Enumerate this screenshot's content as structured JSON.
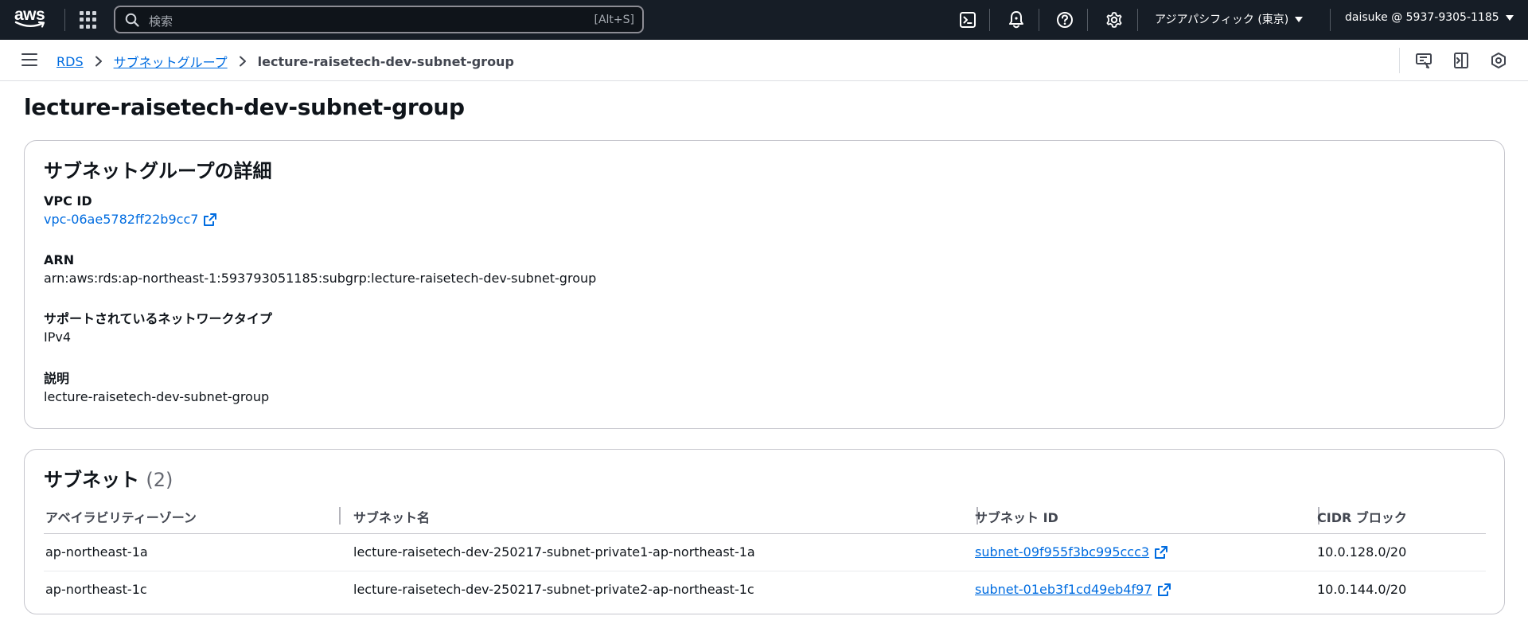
{
  "topnav": {
    "logo_text": "aws",
    "search_placeholder": "検索",
    "search_shortcut": "[Alt+S]",
    "region": "アジアパシフィック (東京)",
    "account": "daisuke @ 5937-9305-1185",
    "icons": [
      "cloudshell-icon",
      "notifications-icon",
      "help-icon",
      "settings-icon"
    ]
  },
  "breadcrumb": {
    "items": [
      "RDS",
      "サブネットグループ",
      "lecture-raisetech-dev-subnet-group"
    ]
  },
  "page": {
    "title": "lecture-raisetech-dev-subnet-group"
  },
  "details": {
    "title": "サブネットグループの詳細",
    "vpc_label": "VPC ID",
    "vpc_value": "vpc-06ae5782ff22b9cc7",
    "arn_label": "ARN",
    "arn_value": "arn:aws:rds:ap-northeast-1:593793051185:subgrp:lecture-raisetech-dev-subnet-group",
    "network_label": "サポートされているネットワークタイプ",
    "network_value": "IPv4",
    "desc_label": "説明",
    "desc_value": "lecture-raisetech-dev-subnet-group"
  },
  "subnets": {
    "title": "サブネット",
    "count": "(2)",
    "columns": [
      "アベイラビリティーゾーン",
      "サブネット名",
      "サブネット ID",
      "CIDR ブロック"
    ],
    "rows": [
      {
        "az": "ap-northeast-1a",
        "name": "lecture-raisetech-dev-250217-subnet-private1-ap-northeast-1a",
        "id": "subnet-09f955f3bc995ccc3",
        "cidr": "10.0.128.0/20"
      },
      {
        "az": "ap-northeast-1c",
        "name": "lecture-raisetech-dev-250217-subnet-private2-ap-northeast-1c",
        "id": "subnet-01eb3f1cd49eb4f97",
        "cidr": "10.0.144.0/20"
      }
    ]
  },
  "colors": {
    "nav_bg": "#161d26",
    "link": "#006ce0",
    "text": "#0f141a",
    "border": "#c6c6cd"
  }
}
